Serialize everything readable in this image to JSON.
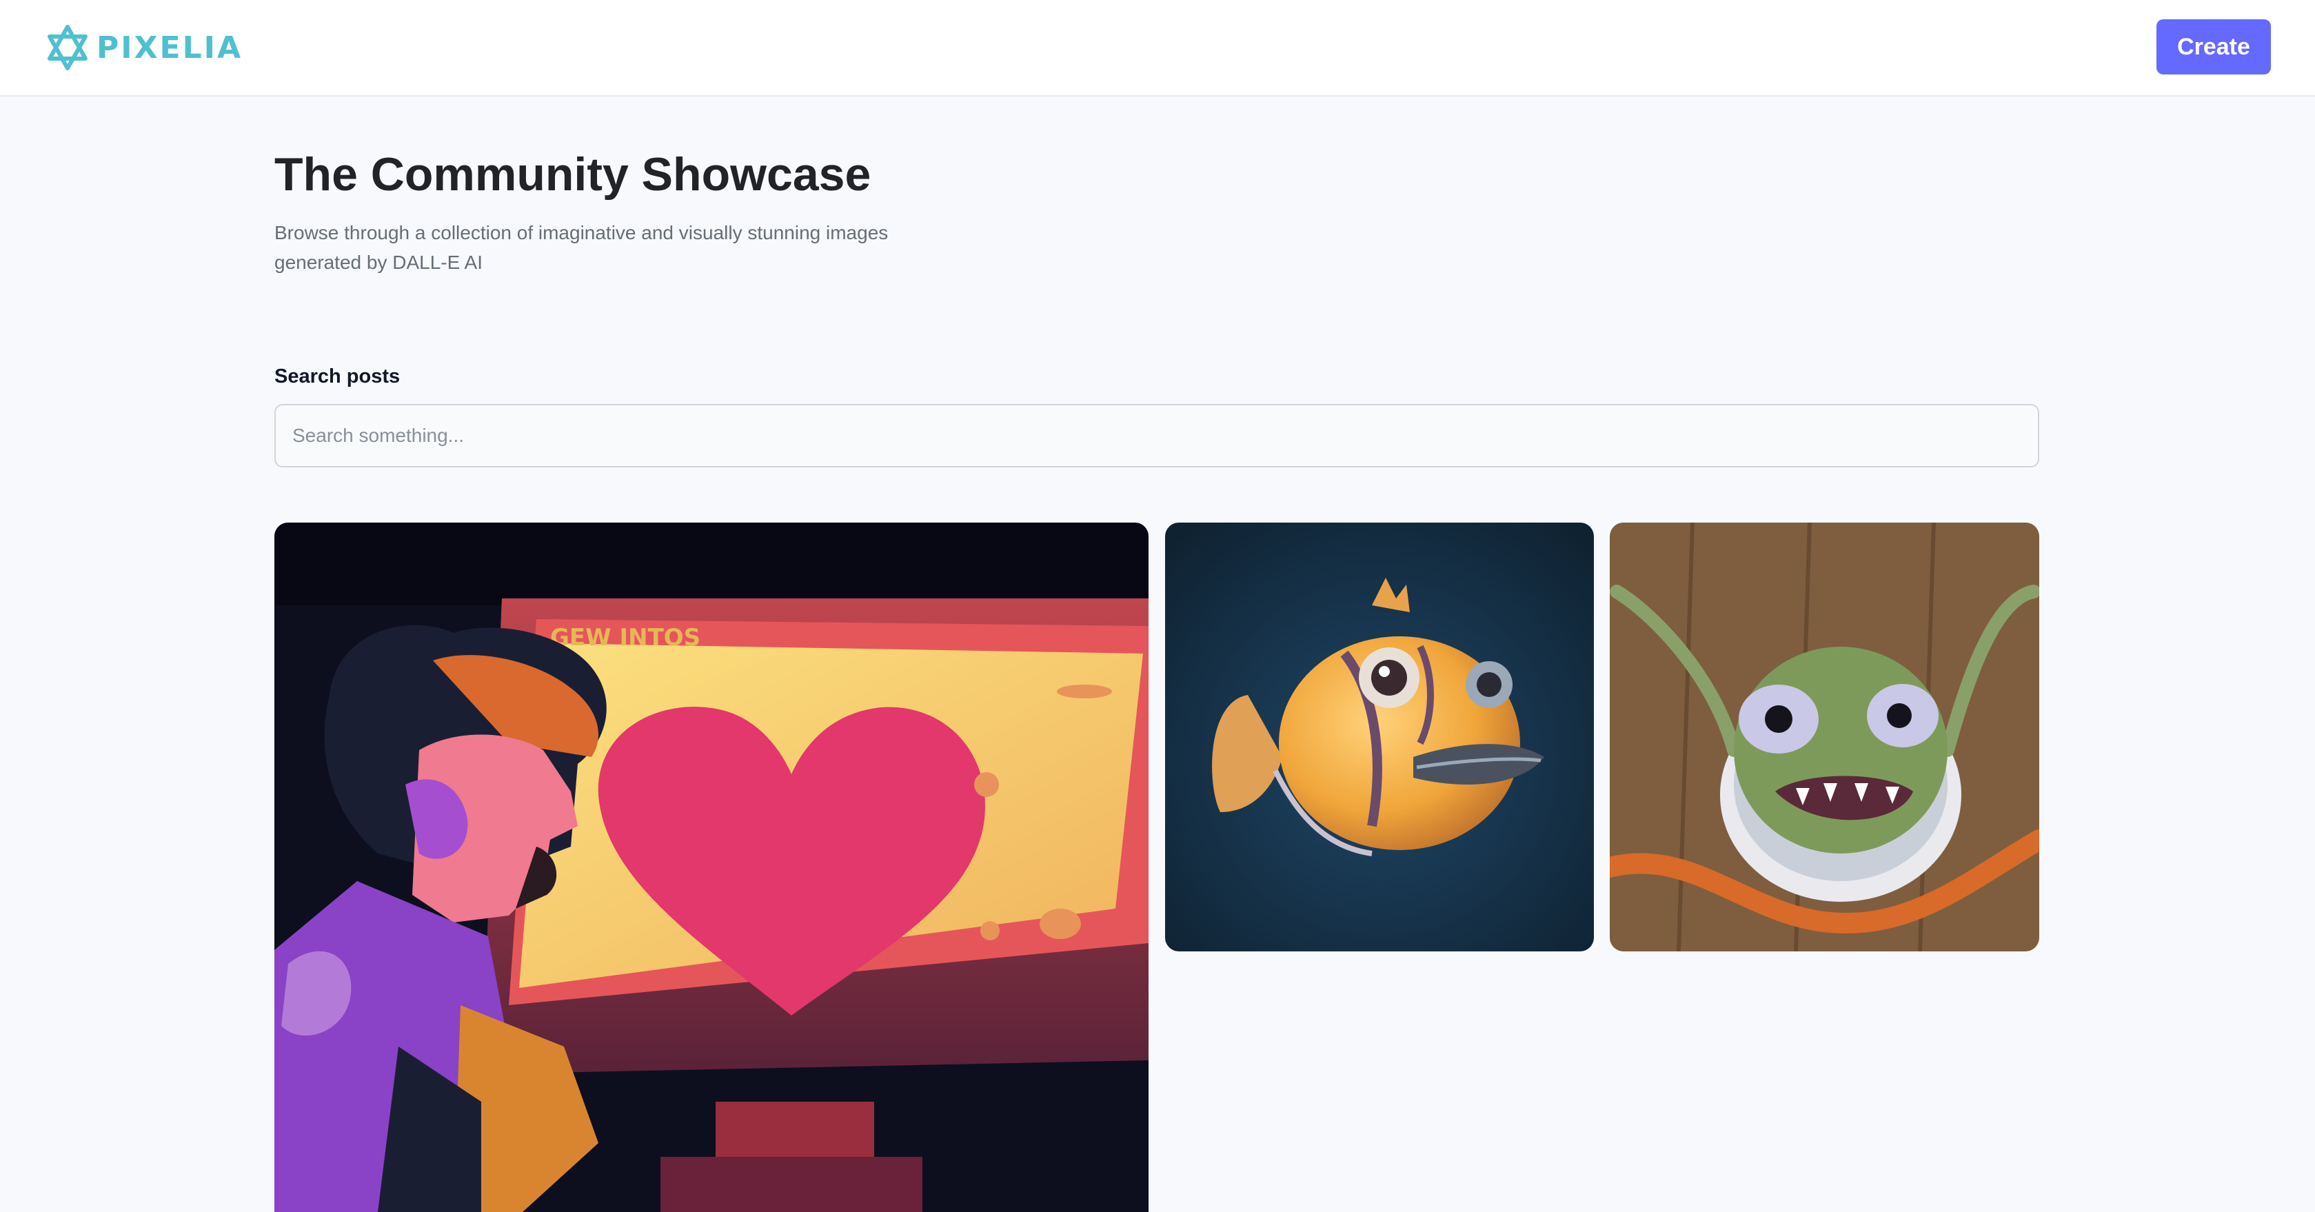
{
  "brand": {
    "name": "PIXELIA",
    "color": "#4fc0d0"
  },
  "header": {
    "create_label": "Create",
    "accent": "#6469ff"
  },
  "hero": {
    "title": "The Community Showcase",
    "subtitle": "Browse through a collection of imaginative and visually stunning images generated by DALL-E AI"
  },
  "search": {
    "label": "Search posts",
    "placeholder": "Search something...",
    "value": ""
  },
  "posts": [
    {
      "screen_text": "GEW INTOS"
    },
    {},
    {}
  ]
}
